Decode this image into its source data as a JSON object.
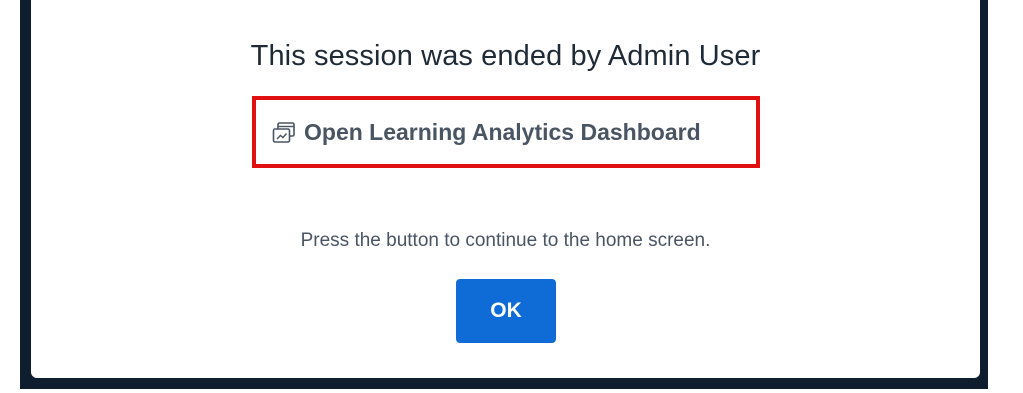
{
  "dialog": {
    "title": "This session was ended by Admin User",
    "dashboard_link": {
      "label": "Open Learning Analytics Dashboard",
      "icon": "dashboard-windows-icon"
    },
    "hint": "Press the button to continue to the home screen.",
    "ok_label": "OK"
  },
  "colors": {
    "backdrop": "#0f1e2e",
    "primary_button": "#0f6cd6",
    "highlight_border": "#e01010",
    "title_text": "#1f2a37",
    "secondary_text": "#4a5563"
  }
}
